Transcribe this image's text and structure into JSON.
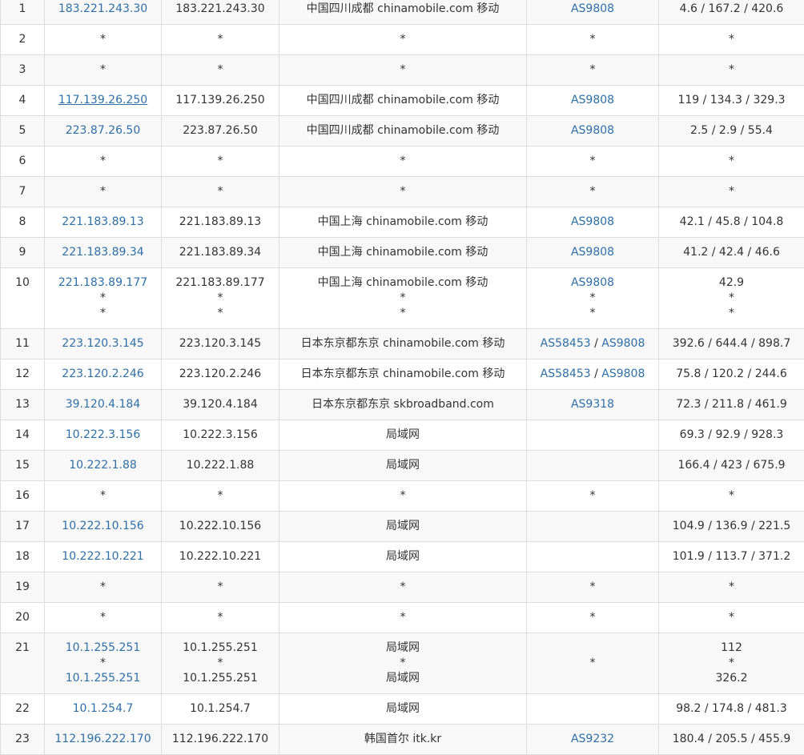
{
  "hops": [
    {
      "hop": "1",
      "ip_link": [
        "183.221.243.30"
      ],
      "ip": [
        "183.221.243.30"
      ],
      "location": [
        "中国四川成都 chinamobile.com 移动"
      ],
      "asn": [
        [
          "AS9808"
        ]
      ],
      "latency": [
        "4.6 / 167.2 / 420.6"
      ]
    },
    {
      "hop": "2",
      "ip_link": [
        "*"
      ],
      "ip": [
        "*"
      ],
      "location": [
        "*"
      ],
      "asn": [
        [
          "*"
        ]
      ],
      "latency": [
        "*"
      ]
    },
    {
      "hop": "3",
      "ip_link": [
        "*"
      ],
      "ip": [
        "*"
      ],
      "location": [
        "*"
      ],
      "asn": [
        [
          "*"
        ]
      ],
      "latency": [
        "*"
      ]
    },
    {
      "hop": "4",
      "ip_link": [
        "117.139.26.250"
      ],
      "ip": [
        "117.139.26.250"
      ],
      "location": [
        "中国四川成都 chinamobile.com 移动"
      ],
      "asn": [
        [
          "AS9808"
        ]
      ],
      "latency": [
        "119 / 134.3 / 329.3"
      ],
      "hovered": true
    },
    {
      "hop": "5",
      "ip_link": [
        "223.87.26.50"
      ],
      "ip": [
        "223.87.26.50"
      ],
      "location": [
        "中国四川成都 chinamobile.com 移动"
      ],
      "asn": [
        [
          "AS9808"
        ]
      ],
      "latency": [
        "2.5 / 2.9 / 55.4"
      ]
    },
    {
      "hop": "6",
      "ip_link": [
        "*"
      ],
      "ip": [
        "*"
      ],
      "location": [
        "*"
      ],
      "asn": [
        [
          "*"
        ]
      ],
      "latency": [
        "*"
      ]
    },
    {
      "hop": "7",
      "ip_link": [
        "*"
      ],
      "ip": [
        "*"
      ],
      "location": [
        "*"
      ],
      "asn": [
        [
          "*"
        ]
      ],
      "latency": [
        "*"
      ]
    },
    {
      "hop": "8",
      "ip_link": [
        "221.183.89.13"
      ],
      "ip": [
        "221.183.89.13"
      ],
      "location": [
        "中国上海 chinamobile.com 移动"
      ],
      "asn": [
        [
          "AS9808"
        ]
      ],
      "latency": [
        "42.1 / 45.8 / 104.8"
      ]
    },
    {
      "hop": "9",
      "ip_link": [
        "221.183.89.34"
      ],
      "ip": [
        "221.183.89.34"
      ],
      "location": [
        "中国上海 chinamobile.com 移动"
      ],
      "asn": [
        [
          "AS9808"
        ]
      ],
      "latency": [
        "41.2 / 42.4 / 46.6"
      ]
    },
    {
      "hop": "10",
      "ip_link": [
        "221.183.89.177",
        "*",
        "*"
      ],
      "ip": [
        "221.183.89.177",
        "*",
        "*"
      ],
      "location": [
        "中国上海 chinamobile.com 移动",
        "*",
        "*"
      ],
      "asn": [
        [
          "AS9808"
        ],
        [
          "*"
        ],
        [
          "*"
        ]
      ],
      "latency": [
        "42.9",
        "*",
        "*"
      ]
    },
    {
      "hop": "11",
      "ip_link": [
        "223.120.3.145"
      ],
      "ip": [
        "223.120.3.145"
      ],
      "location": [
        "日本东京都东京 chinamobile.com 移动"
      ],
      "asn": [
        [
          "AS58453",
          "AS9808"
        ]
      ],
      "latency": [
        "392.6 / 644.4 / 898.7"
      ]
    },
    {
      "hop": "12",
      "ip_link": [
        "223.120.2.246"
      ],
      "ip": [
        "223.120.2.246"
      ],
      "location": [
        "日本东京都东京 chinamobile.com 移动"
      ],
      "asn": [
        [
          "AS58453",
          "AS9808"
        ]
      ],
      "latency": [
        "75.8 / 120.2 / 244.6"
      ]
    },
    {
      "hop": "13",
      "ip_link": [
        "39.120.4.184"
      ],
      "ip": [
        "39.120.4.184"
      ],
      "location": [
        "日本东京都东京 skbroadband.com"
      ],
      "asn": [
        [
          "AS9318"
        ]
      ],
      "latency": [
        "72.3 / 211.8 / 461.9"
      ]
    },
    {
      "hop": "14",
      "ip_link": [
        "10.222.3.156"
      ],
      "ip": [
        "10.222.3.156"
      ],
      "location": [
        "局域网"
      ],
      "asn": [
        []
      ],
      "latency": [
        "69.3 / 92.9 / 928.3"
      ]
    },
    {
      "hop": "15",
      "ip_link": [
        "10.222.1.88"
      ],
      "ip": [
        "10.222.1.88"
      ],
      "location": [
        "局域网"
      ],
      "asn": [
        []
      ],
      "latency": [
        "166.4 / 423 / 675.9"
      ]
    },
    {
      "hop": "16",
      "ip_link": [
        "*"
      ],
      "ip": [
        "*"
      ],
      "location": [
        "*"
      ],
      "asn": [
        [
          "*"
        ]
      ],
      "latency": [
        "*"
      ]
    },
    {
      "hop": "17",
      "ip_link": [
        "10.222.10.156"
      ],
      "ip": [
        "10.222.10.156"
      ],
      "location": [
        "局域网"
      ],
      "asn": [
        []
      ],
      "latency": [
        "104.9 / 136.9 / 221.5"
      ]
    },
    {
      "hop": "18",
      "ip_link": [
        "10.222.10.221"
      ],
      "ip": [
        "10.222.10.221"
      ],
      "location": [
        "局域网"
      ],
      "asn": [
        []
      ],
      "latency": [
        "101.9 / 113.7 / 371.2"
      ]
    },
    {
      "hop": "19",
      "ip_link": [
        "*"
      ],
      "ip": [
        "*"
      ],
      "location": [
        "*"
      ],
      "asn": [
        [
          "*"
        ]
      ],
      "latency": [
        "*"
      ]
    },
    {
      "hop": "20",
      "ip_link": [
        "*"
      ],
      "ip": [
        "*"
      ],
      "location": [
        "*"
      ],
      "asn": [
        [
          "*"
        ]
      ],
      "latency": [
        "*"
      ]
    },
    {
      "hop": "21",
      "ip_link": [
        "10.1.255.251",
        "*",
        "10.1.255.251"
      ],
      "ip": [
        "10.1.255.251",
        "*",
        "10.1.255.251"
      ],
      "location": [
        "局域网",
        "*",
        "局域网"
      ],
      "asn": [
        [
          "*"
        ]
      ],
      "latency": [
        "112",
        "*",
        "326.2"
      ]
    },
    {
      "hop": "22",
      "ip_link": [
        "10.1.254.7"
      ],
      "ip": [
        "10.1.254.7"
      ],
      "location": [
        "局域网"
      ],
      "asn": [
        []
      ],
      "latency": [
        "98.2 / 174.8 / 481.3"
      ]
    },
    {
      "hop": "23",
      "ip_link": [
        "112.196.222.170"
      ],
      "ip": [
        "112.196.222.170"
      ],
      "location": [
        "韩国首尔 itk.kr"
      ],
      "asn": [
        [
          "AS9232"
        ]
      ],
      "latency": [
        "180.4 / 205.5 / 455.9"
      ]
    }
  ]
}
